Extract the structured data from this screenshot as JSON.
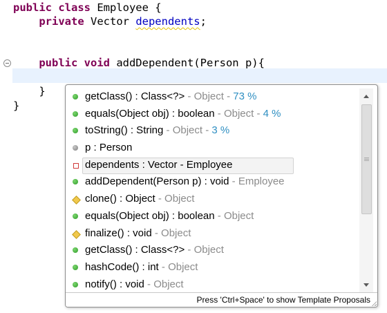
{
  "editor": {
    "line1": {
      "kw": "public class",
      "rest": " Employee {"
    },
    "line2": {
      "indent": "    ",
      "kw": "private",
      "type": " Vector ",
      "field": "dependents",
      "end": ";"
    },
    "line5": {
      "indent": "    ",
      "kw": "public void",
      "rest": " addDependent(Person p){"
    },
    "line7": {
      "text": "    }"
    },
    "line8": {
      "text": "}"
    }
  },
  "popup": {
    "items": [
      {
        "icon": "public",
        "label": "getClass() : Class<?>",
        "qual": " - Object - ",
        "pct": "73 %"
      },
      {
        "icon": "public",
        "label": "equals(Object obj) : boolean",
        "qual": " - Object - ",
        "pct": "4 %"
      },
      {
        "icon": "public",
        "label": "toString() : String",
        "qual": " - Object - ",
        "pct": "3 %"
      },
      {
        "icon": "default",
        "label": "p : Person",
        "qual": "",
        "pct": ""
      },
      {
        "icon": "private",
        "label": "dependents : Vector - Employee",
        "qual": "",
        "pct": ""
      },
      {
        "icon": "public",
        "label": "addDependent(Person p) : void",
        "qual": " - Employee",
        "pct": ""
      },
      {
        "icon": "protected",
        "label": "clone() : Object",
        "qual": " - Object",
        "pct": ""
      },
      {
        "icon": "public",
        "label": "equals(Object obj) : boolean",
        "qual": " - Object",
        "pct": ""
      },
      {
        "icon": "protected",
        "label": "finalize() : void",
        "qual": " - Object",
        "pct": ""
      },
      {
        "icon": "public",
        "label": "getClass() : Class<?>",
        "qual": " - Object",
        "pct": ""
      },
      {
        "icon": "public",
        "label": "hashCode() : int",
        "qual": " - Object",
        "pct": ""
      },
      {
        "icon": "public",
        "label": "notify() : void",
        "qual": " - Object",
        "pct": ""
      }
    ],
    "selected_index": 4,
    "footer_text": "Press 'Ctrl+Space' to show Template Proposals"
  },
  "colors": {
    "keyword": "#7f0055",
    "field": "#0000c0",
    "qualifier": "#8b8b8b",
    "relevance": "#2f8fc2",
    "current_line": "#e8f2fe"
  },
  "icons": {
    "public": "green-circle-icon",
    "default": "gray-circle-icon",
    "private": "red-square-icon",
    "protected": "yellow-diamond-icon"
  }
}
